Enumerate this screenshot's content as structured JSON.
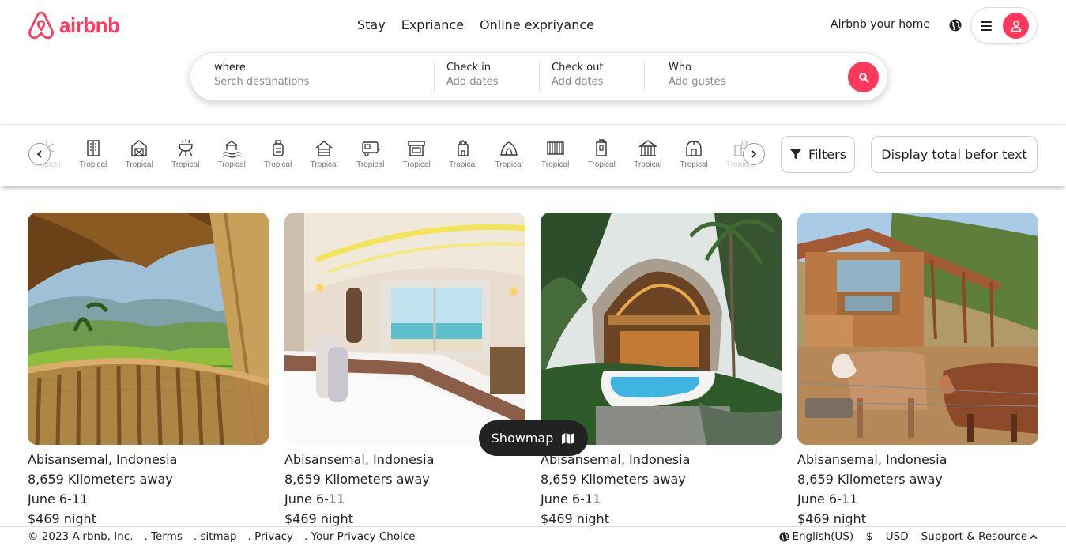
{
  "brand": {
    "name": "airbnb",
    "color": "#ff385c"
  },
  "nav": [
    "Stay",
    "Expriance",
    "Online expriyance"
  ],
  "host_link": "Airbnb your home",
  "search": {
    "where_label": "where",
    "where_value": "Serch destinations",
    "checkin_label": "Check in",
    "checkin_value": "Add dates",
    "checkout_label": "Check out",
    "checkout_value": "Add dates",
    "who_label": "Who",
    "who_value": "Add gustes"
  },
  "categories": [
    {
      "label": "Tropical",
      "icon": "snowflake-icon"
    },
    {
      "label": "Tropical",
      "icon": "building-icon"
    },
    {
      "label": "Tropical",
      "icon": "barn-icon"
    },
    {
      "label": "Tropical",
      "icon": "grill-icon"
    },
    {
      "label": "Tropical",
      "icon": "beach-icon"
    },
    {
      "label": "Tropical",
      "icon": "ice-cream-icon"
    },
    {
      "label": "Tropical",
      "icon": "cabin-icon"
    },
    {
      "label": "Tropical",
      "icon": "camper-icon"
    },
    {
      "label": "Tropical",
      "icon": "shop-icon"
    },
    {
      "label": "Tropical",
      "icon": "castle-icon"
    },
    {
      "label": "Tropical",
      "icon": "cave-icon"
    },
    {
      "label": "Tropical",
      "icon": "piano-icon"
    },
    {
      "label": "Tropical",
      "icon": "tower-icon"
    },
    {
      "label": "Tropical",
      "icon": "pavilion-icon"
    },
    {
      "label": "Tropical",
      "icon": "dome-icon"
    },
    {
      "label": "Tropical",
      "icon": "hotel-icon"
    }
  ],
  "filters_label": "Filters",
  "display_label": "Display total befor text",
  "listings": [
    {
      "location": "Abisansemal, Indonesia",
      "distance": "8,659 Kilometers away",
      "dates": "June 6-11",
      "price": "$469 night"
    },
    {
      "location": "Abisansemal, Indonesia",
      "distance": "8,659 Kilometers away",
      "dates": "June 6-11",
      "price": "$469 night"
    },
    {
      "location": "Abisansemal, Indonesia",
      "distance": "8,659 Kilometers away",
      "dates": "June 6-11",
      "price": "$469 night"
    },
    {
      "location": "Abisansemal, Indonesia",
      "distance": "8,659 Kilometers away",
      "dates": "June 6-11",
      "price": "$469 night"
    }
  ],
  "showmap_label": "Showmap",
  "footer": {
    "copyright": "© 2023 Airbnb, Inc.",
    "links": [
      ". Terms",
      ". sitmap",
      ". Privacy",
      ". Your Privacy Choice"
    ],
    "language": "English(US)",
    "currency_symbol": "$",
    "currency": "USD",
    "support": "Support & Resource"
  }
}
